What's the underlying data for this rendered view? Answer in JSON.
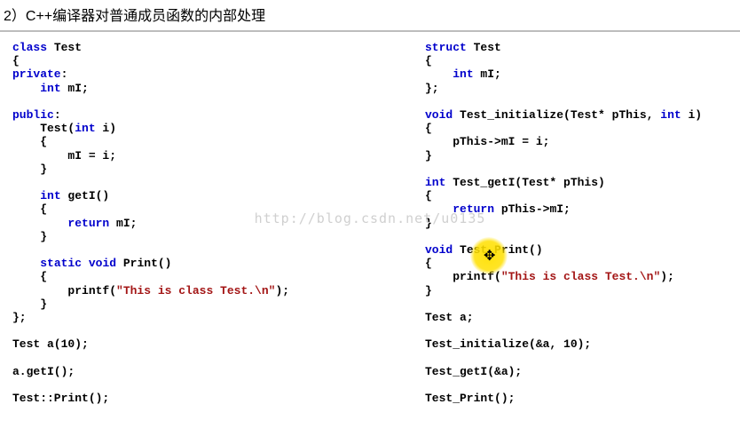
{
  "heading": "2）C++编译器对普通成员函数的内部处理",
  "watermark": "http://blog.csdn.net/u0135",
  "left": {
    "l01a": "class",
    "l01b": " Test",
    "l02": "{",
    "l03a": "private",
    "l03b": ":",
    "l04a": "    ",
    "l04b": "int",
    "l04c": " mI;",
    "l05": "",
    "l06a": "public",
    "l06b": ":",
    "l07a": "    Test(",
    "l07b": "int",
    "l07c": " i)",
    "l08": "    {",
    "l09": "        mI = i;",
    "l10": "    }",
    "l11": "",
    "l12a": "    ",
    "l12b": "int",
    "l12c": " getI()",
    "l13": "    {",
    "l14a": "        ",
    "l14b": "return",
    "l14c": " mI;",
    "l15": "    }",
    "l16": "",
    "l17a": "    ",
    "l17b": "static",
    "l17c": " ",
    "l17d": "void",
    "l17e": " Print()",
    "l18": "    {",
    "l19a": "        printf(",
    "l19b": "\"This is class Test.\\n\"",
    "l19c": ");",
    "l20": "    }",
    "l21": "};",
    "l22": "",
    "l23": "Test a(10);",
    "l24": "",
    "l25": "a.getI();",
    "l26": "",
    "l27": "Test::Print();"
  },
  "right": {
    "r01a": "struct",
    "r01b": " Test",
    "r02": "{",
    "r03a": "    ",
    "r03b": "int",
    "r03c": " mI;",
    "r04": "};",
    "r05": "",
    "r06a": "void",
    "r06b": " Test_initialize(Test* pThis, ",
    "r06c": "int",
    "r06d": " i)",
    "r07": "{",
    "r08": "    pThis->mI = i;",
    "r09": "}",
    "r10": "",
    "r11a": "int",
    "r11b": " Test_getI(Test* pThis)",
    "r12": "{",
    "r13a": "    ",
    "r13b": "return",
    "r13c": " pThis->mI;",
    "r14": "}",
    "r15": "",
    "r16a": "void",
    "r16b": " Test_Print()",
    "r17": "{",
    "r18a": "    printf(",
    "r18b": "\"This is class Test.\\n\"",
    "r18c": ");",
    "r19": "}",
    "r20": "",
    "r21": "Test a;",
    "r22": "",
    "r23": "Test_initialize(&a, 10);",
    "r24": "",
    "r25": "Test_getI(&a);",
    "r26": "",
    "r27": "Test_Print();"
  },
  "cursor_glyph": "✥"
}
